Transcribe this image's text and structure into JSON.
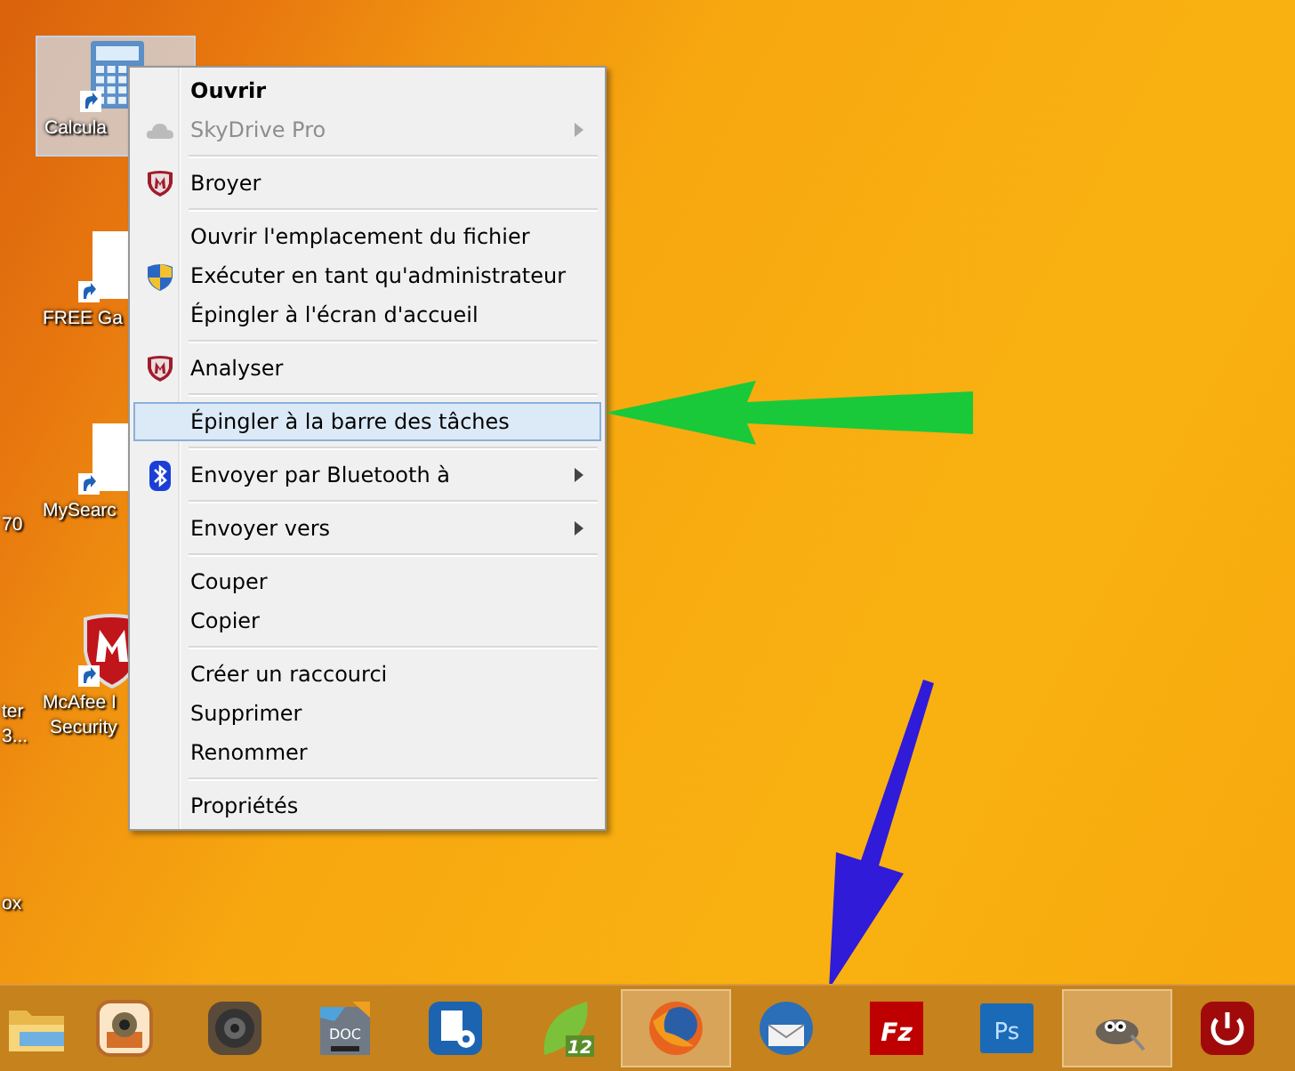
{
  "desktop_icons": [
    {
      "kind": "calculator",
      "lines": [
        "Calcula"
      ],
      "selected": true
    },
    {
      "kind": "blank",
      "lines": [
        "FREE Ga"
      ],
      "selected": false
    },
    {
      "kind": "blank",
      "lines": [
        "MySearc"
      ],
      "selected": false
    },
    {
      "kind": "mcafee",
      "lines": [
        "McAfee I",
        "Security"
      ],
      "selected": false
    }
  ],
  "edge_labels": [
    [
      "70"
    ],
    [
      "ter",
      "3..."
    ],
    [
      "ox"
    ]
  ],
  "context_menu": {
    "groups": [
      [
        {
          "label": "Ouvrir",
          "bold": true,
          "disabled": false,
          "submenu": false,
          "selected": false
        },
        {
          "label": "SkyDrive Pro",
          "kind": "cloud",
          "bold": false,
          "disabled": true,
          "submenu": true,
          "selected": false
        }
      ],
      [
        {
          "label": "Broyer",
          "kind": "shield",
          "bold": false,
          "disabled": false,
          "submenu": false,
          "selected": false
        }
      ],
      [
        {
          "label": "Ouvrir l'emplacement du fichier",
          "bold": false,
          "disabled": false,
          "submenu": false,
          "selected": false
        },
        {
          "label": "Exécuter en tant qu'administrateur",
          "kind": "uac",
          "bold": false,
          "disabled": false,
          "submenu": false,
          "selected": false
        },
        {
          "label": "Épingler à l'écran d'accueil",
          "bold": false,
          "disabled": false,
          "submenu": false,
          "selected": false
        }
      ],
      [
        {
          "label": "Analyser",
          "kind": "shield",
          "bold": false,
          "disabled": false,
          "submenu": false,
          "selected": false
        }
      ],
      [
        {
          "label": "Épingler à la barre des tâches",
          "bold": false,
          "disabled": false,
          "submenu": false,
          "selected": true
        }
      ],
      [
        {
          "label": "Envoyer par Bluetooth à",
          "kind": "bluetooth",
          "bold": false,
          "disabled": false,
          "submenu": true,
          "selected": false
        }
      ],
      [
        {
          "label": "Envoyer vers",
          "bold": false,
          "disabled": false,
          "submenu": true,
          "selected": false
        }
      ],
      [
        {
          "label": "Couper",
          "bold": false,
          "disabled": false,
          "submenu": false,
          "selected": false
        },
        {
          "label": "Copier",
          "bold": false,
          "disabled": false,
          "submenu": false,
          "selected": false
        }
      ],
      [
        {
          "label": "Créer un raccourci",
          "bold": false,
          "disabled": false,
          "submenu": false,
          "selected": false
        },
        {
          "label": "Supprimer",
          "bold": false,
          "disabled": false,
          "submenu": false,
          "selected": false
        },
        {
          "label": "Renommer",
          "bold": false,
          "disabled": false,
          "submenu": false,
          "selected": false
        }
      ],
      [
        {
          "label": "Propriétés",
          "bold": false,
          "disabled": false,
          "submenu": false,
          "selected": false
        }
      ]
    ]
  },
  "taskbar": [
    {
      "kind": "folder",
      "active": false
    },
    {
      "kind": "photo",
      "active": false
    },
    {
      "kind": "speaker",
      "active": false
    },
    {
      "kind": "doc",
      "text": "DOC",
      "active": false
    },
    {
      "kind": "settings",
      "active": false
    },
    {
      "kind": "leaf",
      "text": "12",
      "active": false
    },
    {
      "kind": "firefox",
      "active": true
    },
    {
      "kind": "mail",
      "active": false
    },
    {
      "kind": "filezilla",
      "text": "Fz",
      "active": false
    },
    {
      "kind": "photoshop",
      "text": "Ps",
      "active": false
    },
    {
      "kind": "gimp",
      "active": true
    },
    {
      "kind": "power",
      "active": false
    }
  ]
}
